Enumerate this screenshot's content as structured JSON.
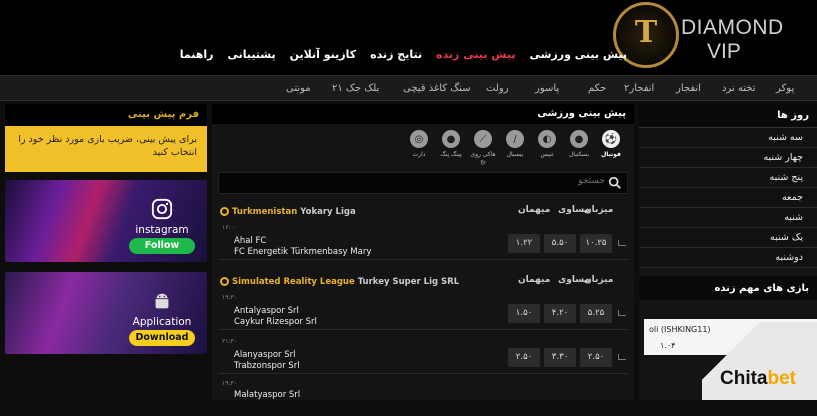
{
  "brand": {
    "logo_letter": "T",
    "name_line1": "DIAMOND",
    "name_line2": "VIP"
  },
  "main_nav": [
    {
      "label": "پیش بینی ورزشی",
      "active": false
    },
    {
      "label": "پیش بینی زنده",
      "active": true
    },
    {
      "label": "نتایج زنده",
      "active": false
    },
    {
      "label": "کازینو آنلاین",
      "active": false
    },
    {
      "label": "پشتیبانی",
      "active": false
    },
    {
      "label": "راهنما",
      "active": false
    }
  ],
  "sub_nav": [
    {
      "label": "پوکر"
    },
    {
      "label": "تخته نرد"
    },
    {
      "label": "انفجار"
    },
    {
      "label": "انفجار۲"
    },
    {
      "label": "حکم"
    },
    {
      "label": "پاسور"
    },
    {
      "label": "رولت"
    },
    {
      "label": "سنگ کاغذ قیچی"
    },
    {
      "label": "بلک جک ۲۱"
    },
    {
      "label": "مونتی"
    }
  ],
  "left": {
    "form_title": "فرم پیش بینی",
    "form_note": "برای پیش بینی، ضریب بازی مورد نظر خود را انتخاب کنید",
    "promo_instagram": {
      "title": "instagram",
      "button": "Follow",
      "icon": "instagram-icon"
    },
    "promo_app": {
      "title": "Application",
      "button": "Download",
      "icon": "android-icon"
    }
  },
  "center": {
    "title": "پیش بینی ورزشی",
    "sports": [
      {
        "label": "فوتبال",
        "icon": "soccer-icon",
        "active": true
      },
      {
        "label": "بسکتبال",
        "icon": "basketball-icon",
        "active": false
      },
      {
        "label": "تنیس",
        "icon": "tennis-icon",
        "active": false
      },
      {
        "label": "بیسبال",
        "icon": "baseball-icon",
        "active": false
      },
      {
        "label": "هاکی روی یخ",
        "icon": "hockey-icon",
        "active": false
      },
      {
        "label": "پینگ پنگ",
        "icon": "pingpong-icon",
        "active": false
      },
      {
        "label": "دارت",
        "icon": "darts-icon",
        "active": false
      }
    ],
    "search_placeholder": "جستجو",
    "columns": {
      "away": "میهمان",
      "draw": "مساوی",
      "home": "میزبان"
    },
    "leagues": [
      {
        "country": "Turkmenistan",
        "name": "Yokary Liga",
        "matches": [
          {
            "time": "۱۶:۰۰",
            "team1": "Ahal FC",
            "team2": "FC Energetik Türkmenbasy Mary",
            "odds": [
              "۱.۲۲",
              "۵.۵۰",
              "۱۰.۲۵"
            ]
          }
        ]
      },
      {
        "country": "Simulated Reality League",
        "name": "Turkey Super Lig SRL",
        "matches": [
          {
            "time": "۱۹:۳۰",
            "team1": "Antalyaspor Srl",
            "team2": "Caykur Rizespor Srl",
            "odds": [
              "۱.۵۰",
              "۴.۲۰",
              "۵.۲۵"
            ]
          },
          {
            "time": "۲۱:۳۰",
            "team1": "Alanyaspor Srl",
            "team2": "Trabzonspor Srl",
            "odds": [
              "۲.۵۰",
              "۳.۳۰",
              "۲.۵۰"
            ]
          },
          {
            "time": "۱۹:۳۰",
            "team1": "Malatyaspor Srl",
            "team2": "",
            "odds": [
              "",
              "",
              ""
            ]
          }
        ]
      }
    ]
  },
  "right": {
    "days_title": "روز ها",
    "days": [
      "سه شنبه",
      "چهار شنبه",
      "پنج شنبه",
      "جمعه",
      "شنبه",
      "یک شنبه",
      "دوشنبه"
    ],
    "live_title": "بازی های مهم زنده",
    "live_snippet": "oli (ISHKING11)",
    "live_odd": "۱.۰۴"
  },
  "watermark": {
    "part1": "Chita",
    "part2": "bet"
  }
}
